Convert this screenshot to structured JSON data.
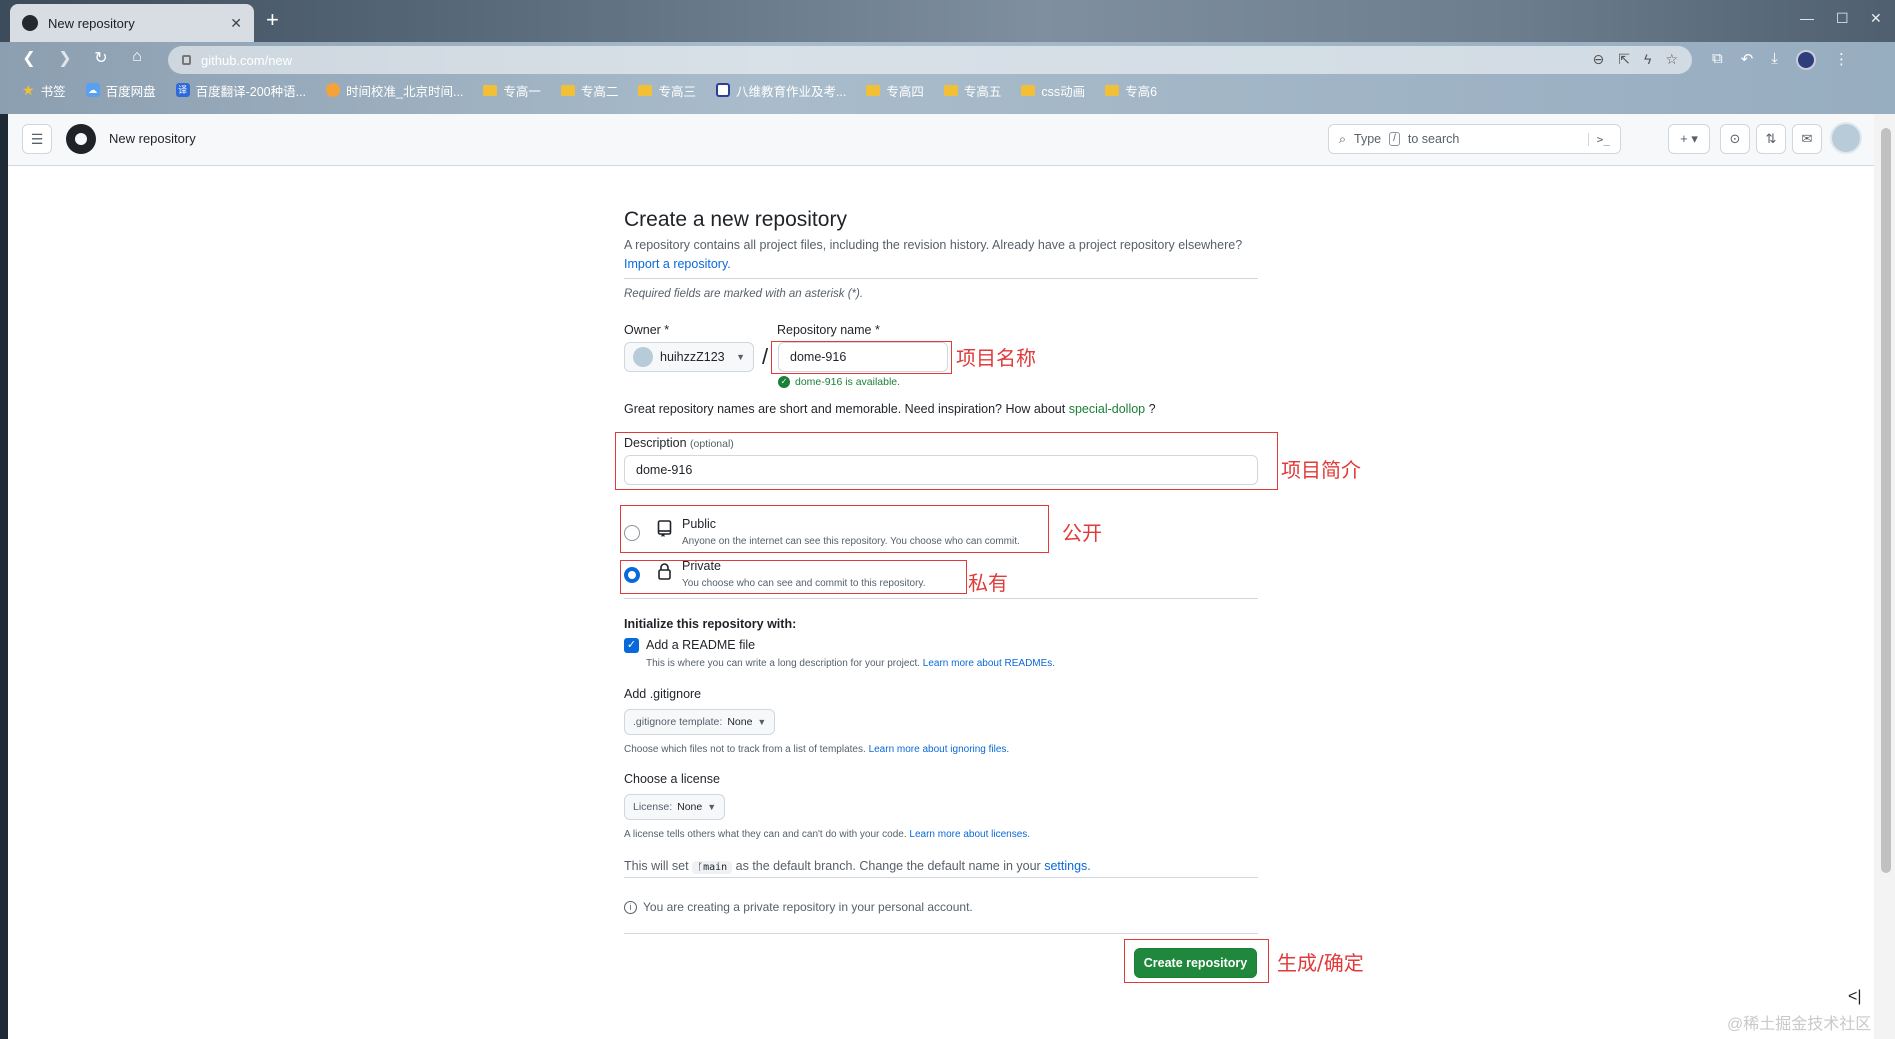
{
  "browser": {
    "tab_title": "New repository",
    "url": "github.com/new",
    "bookmarks": [
      {
        "label": "书签",
        "icon": "star-icon"
      },
      {
        "label": "百度网盘",
        "icon": "cloud-icon"
      },
      {
        "label": "百度翻译-200种语...",
        "icon": "translate-icon"
      },
      {
        "label": "时间校准_北京时间...",
        "icon": "globe-icon"
      },
      {
        "label": "专高一",
        "icon": "folder-icon"
      },
      {
        "label": "专高二",
        "icon": "folder-icon"
      },
      {
        "label": "专高三",
        "icon": "folder-icon"
      },
      {
        "label": "八维教育作业及考...",
        "icon": "page-icon"
      },
      {
        "label": "专高四",
        "icon": "folder-icon"
      },
      {
        "label": "专高五",
        "icon": "folder-icon"
      },
      {
        "label": "css动画",
        "icon": "folder-icon"
      },
      {
        "label": "专高6",
        "icon": "folder-icon"
      }
    ]
  },
  "header": {
    "context": "New repository",
    "search_prefix": "Type",
    "search_key": "/",
    "search_suffix": "to search"
  },
  "form": {
    "title": "Create a new repository",
    "intro": "A repository contains all project files, including the revision history. Already have a project repository elsewhere?",
    "import_link": "Import a repository.",
    "required_note": "Required fields are marked with an asterisk (*).",
    "owner_label": "Owner *",
    "owner_value": "huihzzZ123",
    "repo_name_label": "Repository name *",
    "repo_name_value": "dome-916",
    "availability": "dome-916 is available.",
    "hint_text": "Great repository names are short and memorable. Need inspiration? How about",
    "hint_suggestion": "special-dollop",
    "hint_end": "?",
    "description_label": "Description",
    "description_optional": "(optional)",
    "description_value": "dome-916",
    "public_title": "Public",
    "public_desc": "Anyone on the internet can see this repository. You choose who can commit.",
    "private_title": "Private",
    "private_desc": "You choose who can see and commit to this repository.",
    "init_title": "Initialize this repository with:",
    "readme_label": "Add a README file",
    "readme_desc": "This is where you can write a long description for your project.",
    "readme_link": "Learn more about READMEs.",
    "gitignore_title": "Add .gitignore",
    "gitignore_prefix": ".gitignore template:",
    "gitignore_value": "None",
    "gitignore_desc": "Choose which files not to track from a list of templates.",
    "gitignore_link": "Learn more about ignoring files.",
    "license_title": "Choose a license",
    "license_prefix": "License:",
    "license_value": "None",
    "license_desc": "A license tells others what they can and can't do with your code.",
    "license_link": "Learn more about licenses.",
    "branch_prefix": "This will set",
    "branch_name": "main",
    "branch_suffix": "as the default branch. Change the default name in your",
    "branch_link": "settings.",
    "info_text": "You are creating a private repository in your personal account.",
    "create_button": "Create repository"
  },
  "annotations": {
    "name": "项目名称",
    "description": "项目简介",
    "public": "公开",
    "private": "私有",
    "create": "生成/确定",
    "color": "#e03a3a"
  },
  "watermark": "@稀土掘金技术社区",
  "colors": {
    "primary_button": "#1f883d",
    "link": "#0969da",
    "success": "#1a7f37"
  }
}
